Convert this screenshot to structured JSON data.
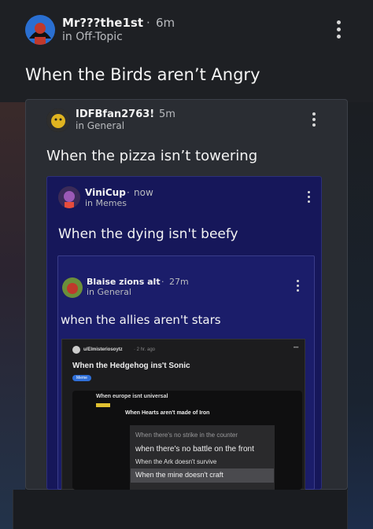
{
  "post1": {
    "user": "Mr???the1st",
    "dot": "·",
    "time": "6m",
    "community": "in Off-Topic",
    "title": "When the Birds aren’t Angry"
  },
  "post2": {
    "user": "IDFBfan2763!",
    "dot": "·",
    "time": "5m",
    "community": "in General",
    "title": "When the pizza isn’t towering"
  },
  "post3": {
    "user": "ViniCup",
    "dot": "·",
    "time": "now",
    "community": "in Memes",
    "title": "When the dying isn't beefy"
  },
  "post4": {
    "user": "Blaise zions alt",
    "dot": "·",
    "time": "27m",
    "community": "in General",
    "title": "when the allies aren't stars"
  },
  "reddit": {
    "user": "u/Elmisteriosoytz",
    "meta": "· 2 hr. ago",
    "title": "When the Hedgehog ins't Sonic",
    "flair": "Meme",
    "more": "•••"
  },
  "dark_card": {
    "line1": "When europe isnt universal",
    "line2": "When Hearts aren't made of Iron"
  },
  "list": {
    "item1": "When there's no strike in the counter",
    "item2": "when there's no battle on the front",
    "item3": "When the Ark doesn't survive",
    "item4": "When the mine doesn't craft"
  },
  "colors": {
    "bg": "#1e2024",
    "blue_card": "#15175c",
    "blue_accent": "#2f5fd8"
  }
}
